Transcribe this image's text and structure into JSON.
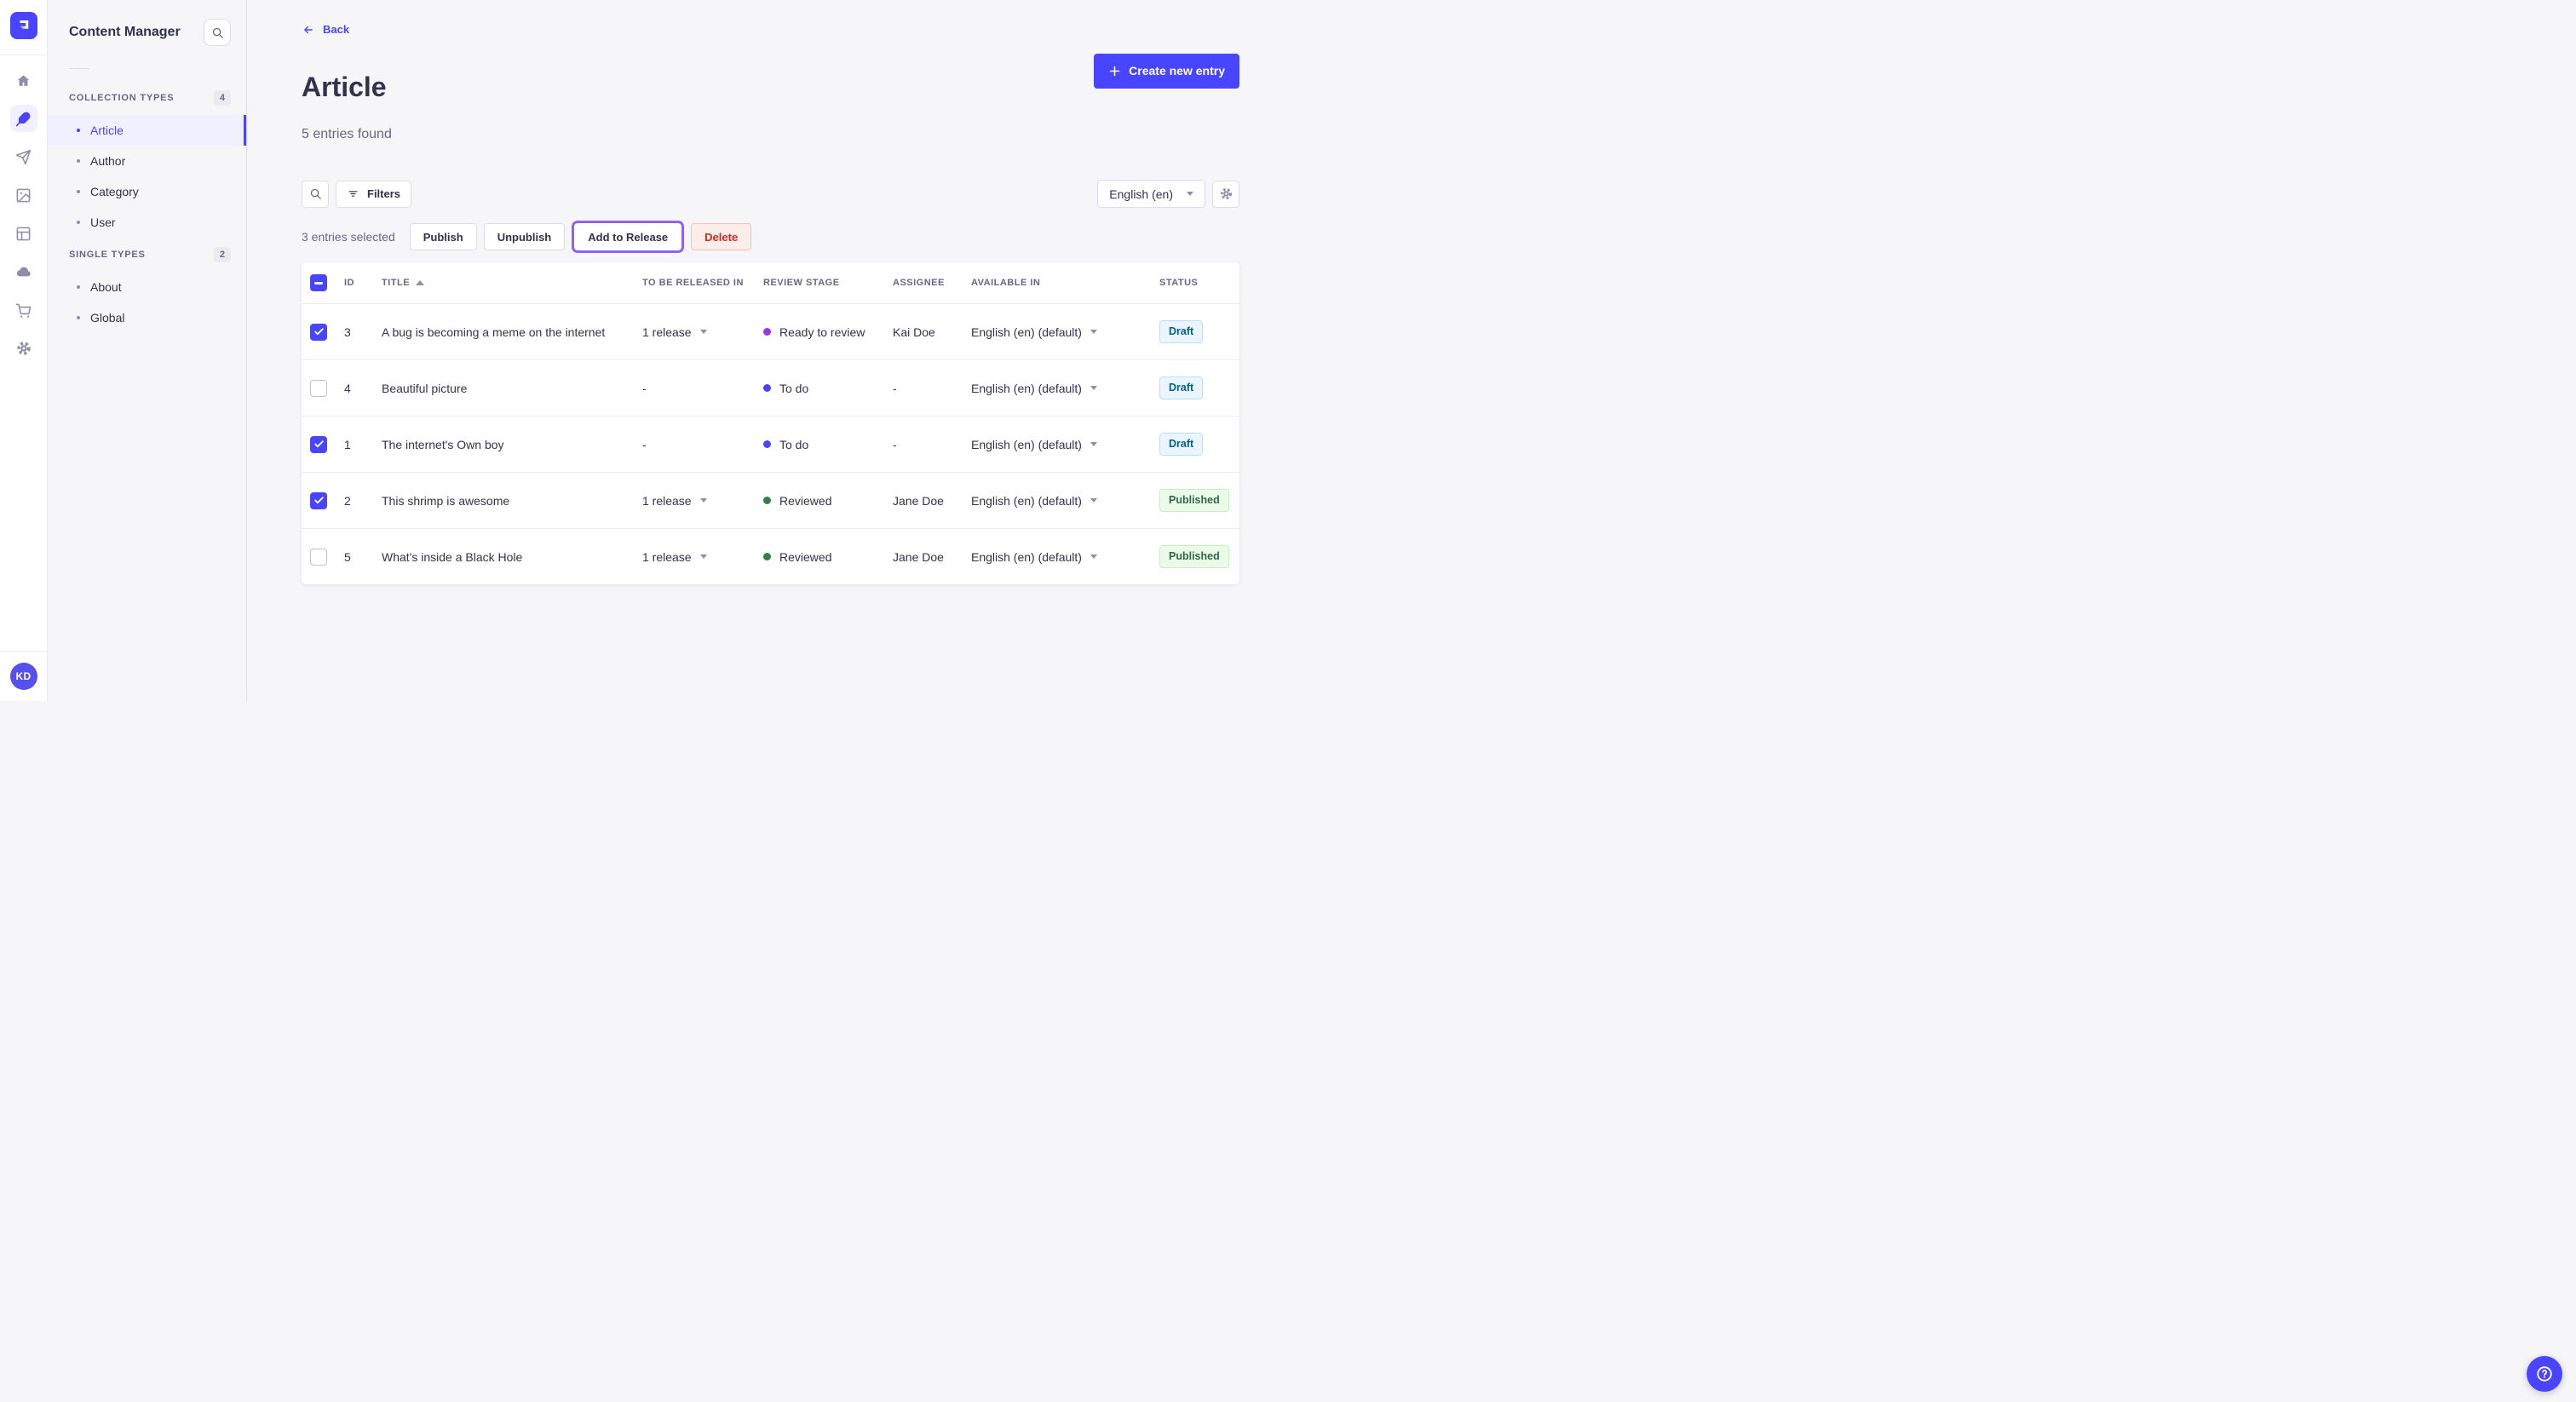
{
  "colors": {
    "primary": "#4945ff",
    "primary_light_bg": "#f0f0ff",
    "text": "#32324d",
    "muted": "#666687",
    "border": "#dcdce4",
    "page_bg": "#f6f6f9",
    "release_focus_ring": "#8f63f0",
    "danger_text": "#d02b20",
    "danger_bg": "#fcecea",
    "draft_text": "#006096",
    "draft_bg": "#eaf5ff",
    "published_text": "#2f6846",
    "published_bg": "#eafbe7",
    "stage_todo": "#4945ff",
    "stage_ready": "#9736e8",
    "stage_reviewed": "#328048"
  },
  "rail": {
    "logo_icon": "strapi-logo",
    "nav_icons": [
      "home",
      "content-manager",
      "releases",
      "media-library",
      "content-type-builder",
      "deploy",
      "marketplace",
      "settings"
    ],
    "active_icon": "content-manager",
    "avatar_initials": "KD"
  },
  "sidebar": {
    "title": "Content Manager",
    "sections": [
      {
        "label": "COLLECTION TYPES",
        "count": "4",
        "items": [
          {
            "label": "Article",
            "active": true
          },
          {
            "label": "Author",
            "active": false
          },
          {
            "label": "Category",
            "active": false
          },
          {
            "label": "User",
            "active": false
          }
        ]
      },
      {
        "label": "SINGLE TYPES",
        "count": "2",
        "items": [
          {
            "label": "About",
            "active": false
          },
          {
            "label": "Global",
            "active": false
          }
        ]
      }
    ]
  },
  "header": {
    "back_label": "Back",
    "title": "Article",
    "subtitle": "5 entries found",
    "create_label": "Create new entry"
  },
  "toolbar": {
    "filters_label": "Filters",
    "locale_value": "English (en)"
  },
  "selection": {
    "count_text": "3 entries selected",
    "publish_label": "Publish",
    "unpublish_label": "Unpublish",
    "add_to_release_label": "Add to Release",
    "delete_label": "Delete"
  },
  "table": {
    "headers": {
      "id": "ID",
      "title": "TITLE",
      "release": "TO BE RELEASED IN",
      "stage": "REVIEW STAGE",
      "assignee": "ASSIGNEE",
      "available": "AVAILABLE IN",
      "status": "STATUS"
    },
    "sort": {
      "column": "TITLE",
      "direction": "asc"
    },
    "header_checkbox_state": "indeterminate",
    "rows": [
      {
        "checked": true,
        "id": "3",
        "title": "A bug is becoming a meme on the internet",
        "release": "1 release",
        "release_has_menu": true,
        "stage": "Ready to review",
        "stage_color": "#9736e8",
        "assignee": "Kai Doe",
        "available": "English (en) (default)",
        "status": "Draft"
      },
      {
        "checked": false,
        "id": "4",
        "title": "Beautiful picture",
        "release": "-",
        "release_has_menu": false,
        "stage": "To do",
        "stage_color": "#4945ff",
        "assignee": "-",
        "available": "English (en) (default)",
        "status": "Draft"
      },
      {
        "checked": true,
        "id": "1",
        "title": "The internet's Own boy",
        "release": "-",
        "release_has_menu": false,
        "stage": "To do",
        "stage_color": "#4945ff",
        "assignee": "-",
        "available": "English (en) (default)",
        "status": "Draft"
      },
      {
        "checked": true,
        "id": "2",
        "title": "This shrimp is awesome",
        "release": "1 release",
        "release_has_menu": true,
        "stage": "Reviewed",
        "stage_color": "#328048",
        "assignee": "Jane Doe",
        "available": "English (en) (default)",
        "status": "Published"
      },
      {
        "checked": false,
        "id": "5",
        "title": "What's inside a Black Hole",
        "release": "1 release",
        "release_has_menu": true,
        "stage": "Reviewed",
        "stage_color": "#328048",
        "assignee": "Jane Doe",
        "available": "English (en) (default)",
        "status": "Published"
      }
    ]
  },
  "help": {
    "icon": "question-mark"
  }
}
